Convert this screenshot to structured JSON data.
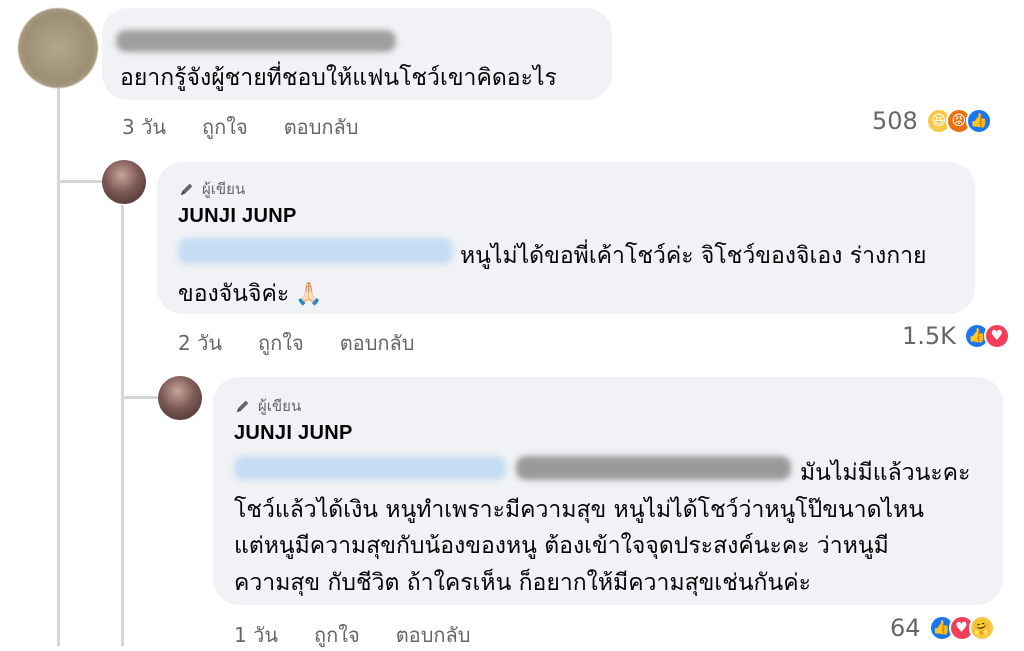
{
  "comment1": {
    "text": "อยากรู้จังผู้ชายที่ชอบให้แฟนโชว์เขาคิดอะไร",
    "time": "3 วัน",
    "like": "ถูกใจ",
    "reply": "ตอบกลับ",
    "reaction_count": "508",
    "reactions": [
      "haha-icon",
      "angry-icon",
      "like-icon"
    ]
  },
  "reply1": {
    "badge": "ผู้เขียน",
    "author": "JUNJI JUNP",
    "line1": "หนูไม่ได้ขอพี่เค้าโชว์ค่ะ จิโชว์ของจิเอง ร่างกาย",
    "line2": "ของจันจิค่ะ",
    "emoji": "🙏🏻",
    "time": "2 วัน",
    "like": "ถูกใจ",
    "reply": "ตอบกลับ",
    "reaction_count": "1.5K",
    "reactions": [
      "like-icon",
      "love-icon"
    ]
  },
  "reply2": {
    "badge": "ผู้เขียน",
    "author": "JUNJI JUNP",
    "line1": "มันไม่มีแล้วนะคะ",
    "line2": "โชว์แล้วได้เงิน หนูทำเพราะมีความสุข หนูไม่ได้โชว์ว่าหนูโป๊ขนาดไหน",
    "line3": "แต่หนูมีความสุขกับน้องของหนู ต้องเข้าใจจุดประสงค์นะคะ ว่าหนูมี",
    "line4": "ความสุข กับชีวิต ถ้าใครเห็น ก็อยากให้มีความสุขเช่นกันค่ะ",
    "time": "1 วัน",
    "like": "ถูกใจ",
    "reply": "ตอบกลับ",
    "reaction_count": "64",
    "reactions": [
      "like-icon",
      "love-icon",
      "care-icon"
    ]
  },
  "colors": {
    "bubble": "#f0f2f5",
    "meta_text": "#65676b",
    "like_blue": "#1877f2",
    "love_red": "#f33e58",
    "mention_blur": "#c6dcf5",
    "name_blur": "#9a9a9a"
  }
}
